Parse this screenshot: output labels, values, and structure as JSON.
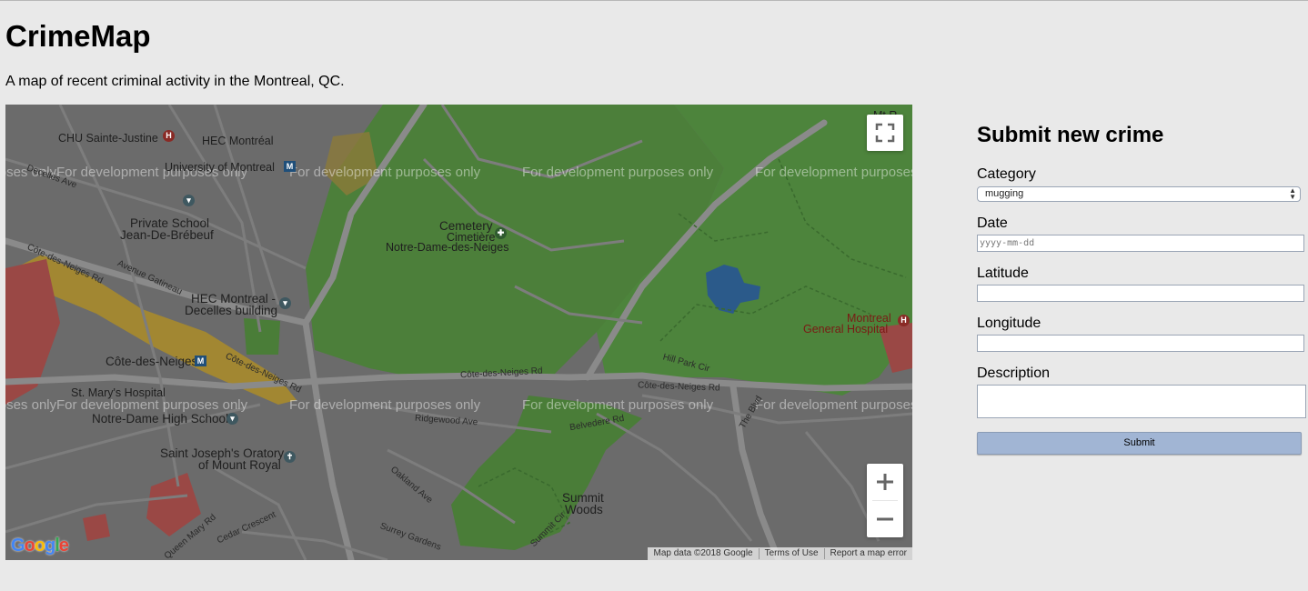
{
  "page": {
    "title": "CrimeMap",
    "subtitle": "A map of recent criminal activity in the Montreal, QC."
  },
  "map": {
    "watermark": "For development purposes only",
    "fullscreen_icon": "fullscreen-icon",
    "zoom_in_icon": "plus-icon",
    "zoom_out_icon": "minus-icon",
    "logo": "Google",
    "attribution": [
      "Map data ©2018 Google",
      "Terms of Use",
      "Report a map error"
    ],
    "places": {
      "chu": "CHU Sainte-Justine",
      "hec": "HEC Montréal",
      "udem": "University of Montreal",
      "private_school_1": "Private School",
      "private_school_2": "Jean-De-Brébeuf",
      "cemetery_1": "Cemetery",
      "cemetery_2": "Cimetière",
      "cemetery_3": "Notre-Dame-des-Neiges",
      "hec_decelles_1": "HEC Montreal -",
      "hec_decelles_2": "Decelles building",
      "cdn_station": "Côte-des-Neiges",
      "st_marys": "St. Mary's Hospital",
      "ndhs": "Notre-Dame High School",
      "oratory_1": "Saint Joseph's Oratory",
      "oratory_2": "of Mount Royal",
      "summit_1": "Summit",
      "summit_2": "Woods",
      "mgh_1": "Montreal",
      "mgh_2": "General Hospital",
      "mt": "Mt R"
    },
    "streets": {
      "decelles": "Decelles Ave",
      "cdn_rd_1": "Côte-des-Neiges Rd",
      "cdn_rd_2": "Côte-des-Neiges Rd",
      "cdn_rd_3": "Côte-des-Neiges Rd",
      "cdn_rd_4": "Côte-des-Neiges Rd",
      "gatineau": "Avenue Gatineau",
      "ridgewood": "Ridgewood Ave",
      "belvedere_rd": "Belvedere Rd",
      "the_blvd": "The Blvd",
      "hill_park": "Hill Park Cir",
      "summit_cir": "Summit Cir",
      "queen_mary": "Queen Mary Rd",
      "cedar": "Cedar Crescent",
      "surrey": "Surrey Gardens",
      "oakland": "Oakland Ave"
    }
  },
  "form": {
    "heading": "Submit new crime",
    "category_label": "Category",
    "category_value": "mugging",
    "date_label": "Date",
    "date_placeholder": "yyyy-mm-dd",
    "latitude_label": "Latitude",
    "latitude_value": "",
    "longitude_label": "Longitude",
    "longitude_value": "",
    "description_label": "Description",
    "description_value": "",
    "submit_label": "Submit"
  },
  "colors": {
    "page_bg": "#e9e9e9",
    "map_base": "#6e6e6e",
    "park_green": "#4f8a3c",
    "water_blue": "#2b5a8a",
    "button_blue": "#a1b5d4"
  }
}
